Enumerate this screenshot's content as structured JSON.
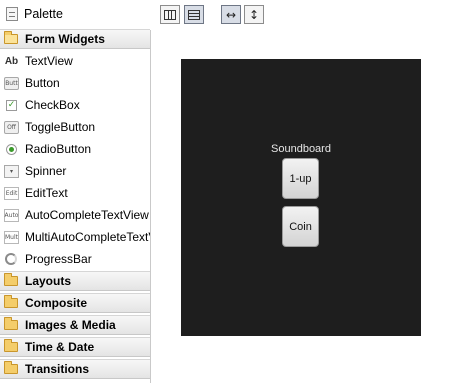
{
  "palette": {
    "title": "Palette",
    "categories": {
      "form_widgets": "Form Widgets",
      "layouts": "Layouts",
      "composite": "Composite",
      "images_media": "Images & Media",
      "time_date": "Time & Date",
      "transitions": "Transitions"
    },
    "widgets": [
      {
        "label": "TextView",
        "icon": "Ab"
      },
      {
        "label": "Button",
        "icon": "Butt"
      },
      {
        "label": "CheckBox",
        "icon": "✓"
      },
      {
        "label": "ToggleButton",
        "icon": "Off"
      },
      {
        "label": "RadioButton",
        "icon": ""
      },
      {
        "label": "Spinner",
        "icon": "▾"
      },
      {
        "label": "EditText",
        "icon": "Edit"
      },
      {
        "label": "AutoCompleteTextView",
        "icon": "Auto"
      },
      {
        "label": "MultiAutoCompleteTextView",
        "icon": "Mult"
      },
      {
        "label": "ProgressBar",
        "icon": ""
      }
    ]
  },
  "toolbar": {
    "buttons": [
      "horizontal-layout",
      "vertical-layout",
      "fill-width",
      "fill-height"
    ],
    "fill_width_glyph": "↔",
    "fill_height_glyph": "↕"
  },
  "canvas": {
    "device_background": "#1e1e1e",
    "label": "Soundboard",
    "buttons": [
      "1-up",
      "Coin"
    ]
  }
}
